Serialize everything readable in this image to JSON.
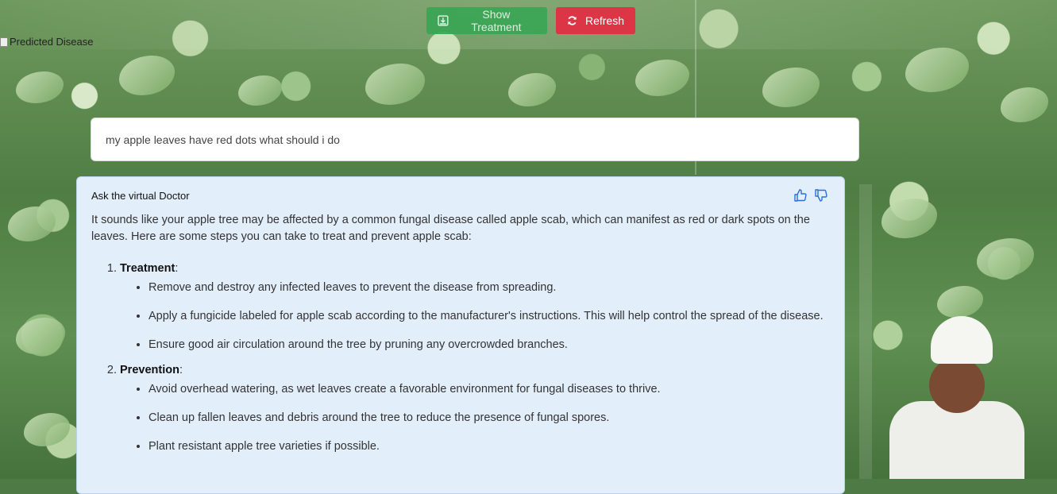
{
  "toolbar": {
    "show_treatment_label": "Show Treatment",
    "refresh_label": "Refresh",
    "colors": {
      "show_treatment": "#3aa655",
      "refresh": "#dc3545"
    }
  },
  "predicted_image": {
    "alt_text": "Predicted Disease"
  },
  "query": {
    "value": "my apple leaves have red dots what should i do"
  },
  "response": {
    "title": "Ask the virtual Doctor",
    "intro": "It sounds like your apple tree may be affected by a common fungal disease called apple scab, which can manifest as red or dark spots on the leaves. Here are some steps you can take to treat and prevent apple scab:",
    "steps": [
      {
        "heading": "Treatment",
        "items": [
          "Remove and destroy any infected leaves to prevent the disease from spreading.",
          "Apply a fungicide labeled for apple scab according to the manufacturer's instructions. This will help control the spread of the disease.",
          "Ensure good air circulation around the tree by pruning any overcrowded branches."
        ]
      },
      {
        "heading": "Prevention",
        "items": [
          "Avoid overhead watering, as wet leaves create a favorable environment for fungal diseases to thrive.",
          "Clean up fallen leaves and debris around the tree to reduce the presence of fungal spores.",
          "Plant resistant apple tree varieties if possible."
        ]
      }
    ],
    "icons": {
      "like": "thumbs-up-icon",
      "dislike": "thumbs-down-icon"
    },
    "card_color": "#e3eefb"
  }
}
